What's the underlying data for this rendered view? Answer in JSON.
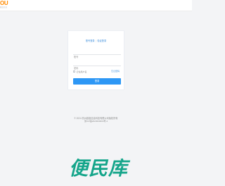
{
  "header": {
    "logo_text": "OU",
    "logo_subtext": "欧度信息"
  },
  "login": {
    "tabs": {
      "account_login": "账号登录",
      "sms_login": "验证登录"
    },
    "account_placeholder": "账号",
    "password_placeholder": "密码",
    "remember_label": "记住用户名",
    "forgot_label": "忘记密码",
    "submit_label": "登录"
  },
  "footer": {
    "copyright": "© 2024 杭州欧度信息科技有限公司版权所有",
    "icp": "浙ICP备2023000000号-2"
  },
  "watermark": {
    "text": "便民库"
  },
  "colors": {
    "accent": "#2d97f5",
    "link": "#3f8fdc",
    "watermark": "#14a58a",
    "logo": "#ff8a00",
    "background": "#f3f4f6"
  }
}
